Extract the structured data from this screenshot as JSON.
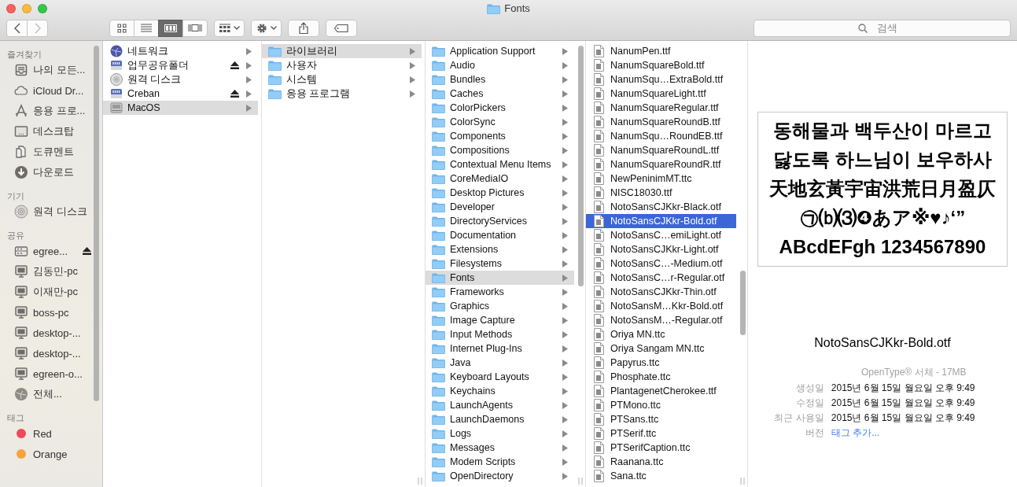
{
  "window": {
    "title": "Fonts"
  },
  "toolbar": {
    "view_modes": [
      {
        "kind": "icons",
        "selected": false
      },
      {
        "kind": "list",
        "selected": false
      },
      {
        "kind": "columns",
        "selected": true
      },
      {
        "kind": "coverflow",
        "selected": false
      }
    ],
    "search": {
      "placeholder": "검색"
    }
  },
  "sidebar": {
    "sections": [
      {
        "title": "즐겨찾기",
        "items": [
          {
            "label": "나의 모든...",
            "kind": "tray",
            "eject": false
          },
          {
            "label": "iCloud Dr...",
            "kind": "cloud",
            "eject": false
          },
          {
            "label": "응용 프로...",
            "kind": "apps",
            "eject": false
          },
          {
            "label": "데스크탑",
            "kind": "desktop",
            "eject": false
          },
          {
            "label": "도큐멘트",
            "kind": "document",
            "eject": false
          },
          {
            "label": "다운로드",
            "kind": "download",
            "eject": false
          }
        ]
      },
      {
        "title": "기기",
        "items": [
          {
            "label": "원격 디스크",
            "kind": "disc",
            "eject": false
          }
        ]
      },
      {
        "title": "공유",
        "items": [
          {
            "label": "egree...",
            "kind": "server",
            "eject": true
          },
          {
            "label": "김동민-pc",
            "kind": "computer",
            "eject": false
          },
          {
            "label": "이재만-pc",
            "kind": "computer",
            "eject": false
          },
          {
            "label": "boss-pc",
            "kind": "computer",
            "eject": false
          },
          {
            "label": "desktop-...",
            "kind": "computer",
            "eject": false
          },
          {
            "label": "desktop-...",
            "kind": "computer",
            "eject": false
          },
          {
            "label": "egreen-o...",
            "kind": "computer",
            "eject": false
          },
          {
            "label": "전체...",
            "kind": "network",
            "eject": false
          }
        ]
      },
      {
        "title": "태그",
        "items": [
          {
            "label": "Red",
            "kind": "tag",
            "color": "#f0495c"
          },
          {
            "label": "Orange",
            "kind": "tag",
            "color": "#f5a33a"
          }
        ]
      }
    ]
  },
  "columns": [
    {
      "active": false,
      "items": [
        {
          "label": "네트워크",
          "kind": "network",
          "eject": false,
          "selected": false
        },
        {
          "label": "업무공유폴더",
          "kind": "server",
          "eject": true,
          "selected": false
        },
        {
          "label": "원격 디스크",
          "kind": "disc",
          "eject": false,
          "selected": false
        },
        {
          "label": "Creban",
          "kind": "server",
          "eject": true,
          "selected": false
        },
        {
          "label": "MacOS",
          "kind": "drive",
          "eject": false,
          "selected": true
        }
      ]
    },
    {
      "active": false,
      "items": [
        {
          "label": "라이브러리",
          "kind": "folder",
          "selected": true
        },
        {
          "label": "사용자",
          "kind": "folder",
          "selected": false
        },
        {
          "label": "시스템",
          "kind": "folder",
          "selected": false
        },
        {
          "label": "응용 프로그램",
          "kind": "folder",
          "selected": false
        }
      ]
    },
    {
      "active": false,
      "items": [
        {
          "label": "Application Support",
          "kind": "folder",
          "selected": false
        },
        {
          "label": "Audio",
          "kind": "folder",
          "selected": false
        },
        {
          "label": "Bundles",
          "kind": "folder",
          "selected": false
        },
        {
          "label": "Caches",
          "kind": "folder",
          "selected": false
        },
        {
          "label": "ColorPickers",
          "kind": "folder",
          "selected": false
        },
        {
          "label": "ColorSync",
          "kind": "folder",
          "selected": false
        },
        {
          "label": "Components",
          "kind": "folder",
          "selected": false
        },
        {
          "label": "Compositions",
          "kind": "folder",
          "selected": false
        },
        {
          "label": "Contextual Menu Items",
          "kind": "folder",
          "selected": false
        },
        {
          "label": "CoreMediaIO",
          "kind": "folder",
          "selected": false
        },
        {
          "label": "Desktop Pictures",
          "kind": "folder",
          "selected": false
        },
        {
          "label": "Developer",
          "kind": "folder",
          "selected": false
        },
        {
          "label": "DirectoryServices",
          "kind": "folder",
          "selected": false
        },
        {
          "label": "Documentation",
          "kind": "folder",
          "selected": false
        },
        {
          "label": "Extensions",
          "kind": "folder",
          "selected": false
        },
        {
          "label": "Filesystems",
          "kind": "folder",
          "selected": false
        },
        {
          "label": "Fonts",
          "kind": "folder",
          "selected": true
        },
        {
          "label": "Frameworks",
          "kind": "folder",
          "selected": false
        },
        {
          "label": "Graphics",
          "kind": "folder",
          "selected": false
        },
        {
          "label": "Image Capture",
          "kind": "folder",
          "selected": false
        },
        {
          "label": "Input Methods",
          "kind": "folder",
          "selected": false
        },
        {
          "label": "Internet Plug-Ins",
          "kind": "folder",
          "selected": false
        },
        {
          "label": "Java",
          "kind": "folder",
          "selected": false
        },
        {
          "label": "Keyboard Layouts",
          "kind": "folder",
          "selected": false
        },
        {
          "label": "Keychains",
          "kind": "folder",
          "selected": false
        },
        {
          "label": "LaunchAgents",
          "kind": "folder",
          "selected": false
        },
        {
          "label": "LaunchDaemons",
          "kind": "folder",
          "selected": false
        },
        {
          "label": "Logs",
          "kind": "folder",
          "selected": false
        },
        {
          "label": "Messages",
          "kind": "folder",
          "selected": false
        },
        {
          "label": "Modem Scripts",
          "kind": "folder",
          "selected": false
        },
        {
          "label": "OpenDirectory",
          "kind": "folder",
          "selected": false
        }
      ]
    },
    {
      "active": true,
      "items": [
        {
          "label": "NanumPen.ttf",
          "kind": "file",
          "selected": false
        },
        {
          "label": "NanumSquareBold.ttf",
          "kind": "file",
          "selected": false
        },
        {
          "label": "NanumSqu…ExtraBold.ttf",
          "kind": "file",
          "selected": false
        },
        {
          "label": "NanumSquareLight.ttf",
          "kind": "file",
          "selected": false
        },
        {
          "label": "NanumSquareRegular.ttf",
          "kind": "file",
          "selected": false
        },
        {
          "label": "NanumSquareRoundB.ttf",
          "kind": "file",
          "selected": false
        },
        {
          "label": "NanumSqu…RoundEB.ttf",
          "kind": "file",
          "selected": false
        },
        {
          "label": "NanumSquareRoundL.ttf",
          "kind": "file",
          "selected": false
        },
        {
          "label": "NanumSquareRoundR.ttf",
          "kind": "file",
          "selected": false
        },
        {
          "label": "NewPeninimMT.ttc",
          "kind": "file",
          "selected": false
        },
        {
          "label": "NISC18030.ttf",
          "kind": "file",
          "selected": false
        },
        {
          "label": "NotoSansCJKkr-Black.otf",
          "kind": "file",
          "selected": false
        },
        {
          "label": "NotoSansCJKkr-Bold.otf",
          "kind": "file",
          "selected": true
        },
        {
          "label": "NotoSansC…emiLight.otf",
          "kind": "file",
          "selected": false
        },
        {
          "label": "NotoSansCJKkr-Light.otf",
          "kind": "file",
          "selected": false
        },
        {
          "label": "NotoSansC…-Medium.otf",
          "kind": "file",
          "selected": false
        },
        {
          "label": "NotoSansC…r-Regular.otf",
          "kind": "file",
          "selected": false
        },
        {
          "label": "NotoSansCJKkr-Thin.otf",
          "kind": "file",
          "selected": false
        },
        {
          "label": "NotoSansM…Kkr-Bold.otf",
          "kind": "file",
          "selected": false
        },
        {
          "label": "NotoSansM…-Regular.otf",
          "kind": "file",
          "selected": false
        },
        {
          "label": "Oriya MN.ttc",
          "kind": "file",
          "selected": false
        },
        {
          "label": "Oriya Sangam MN.ttc",
          "kind": "file",
          "selected": false
        },
        {
          "label": "Papyrus.ttc",
          "kind": "file",
          "selected": false
        },
        {
          "label": "Phosphate.ttc",
          "kind": "file",
          "selected": false
        },
        {
          "label": "PlantagenetCherokee.ttf",
          "kind": "file",
          "selected": false
        },
        {
          "label": "PTMono.ttc",
          "kind": "file",
          "selected": false
        },
        {
          "label": "PTSans.ttc",
          "kind": "file",
          "selected": false
        },
        {
          "label": "PTSerif.ttc",
          "kind": "file",
          "selected": false
        },
        {
          "label": "PTSerifCaption.ttc",
          "kind": "file",
          "selected": false
        },
        {
          "label": "Raanana.ttc",
          "kind": "file",
          "selected": false
        },
        {
          "label": "Sana.ttc",
          "kind": "file",
          "selected": false
        }
      ]
    }
  ],
  "preview": {
    "sample_lines": [
      "동해물과 백두산이 마르고",
      "닳도록 하느님이 보우하사",
      "天地玄黃宇宙洪荒日月盈仄",
      "㉠⒝⑶❹あア※♥♪‘”",
      "ABcdEFgh 1234567890"
    ],
    "filename": "NotoSansCJKkr-Bold.otf",
    "summary": "OpenType® 서체 - 17MB",
    "details": [
      {
        "label": "생성일",
        "value": "2015년 6월 15일 월요일 오후 9:49",
        "kind": "text"
      },
      {
        "label": "수정일",
        "value": "2015년 6월 15일 월요일 오후 9:49",
        "kind": "text"
      },
      {
        "label": "최근 사용일",
        "value": "2015년 6월 15일 월요일 오후 9:49",
        "kind": "text"
      },
      {
        "label": "버전",
        "value": "태그 추가...",
        "kind": "link"
      }
    ]
  }
}
